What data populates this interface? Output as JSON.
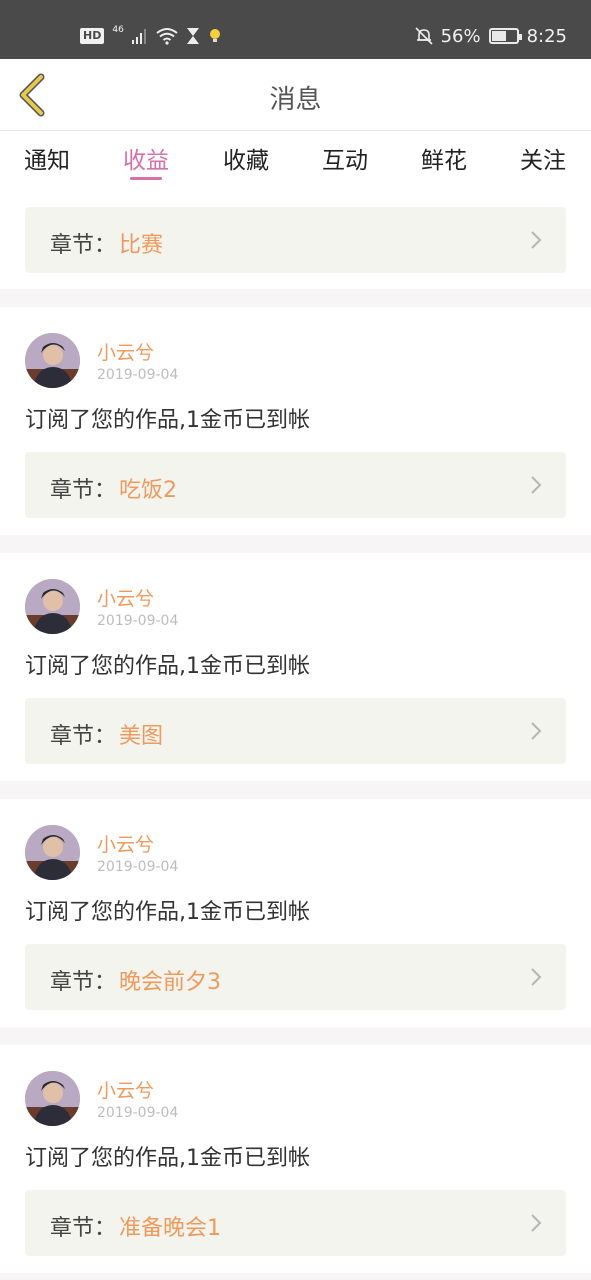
{
  "status_bar": {
    "hd": "HD",
    "network": "46",
    "battery_text": "56%",
    "battery_level": 0.56,
    "time": "8:25"
  },
  "header": {
    "title": "消息"
  },
  "tabs": [
    {
      "label": "通知"
    },
    {
      "label": "收益"
    },
    {
      "label": "收藏"
    },
    {
      "label": "互动"
    },
    {
      "label": "鲜花"
    },
    {
      "label": "关注"
    }
  ],
  "active_tab": "收益",
  "chapter_label": "章节：",
  "first_card": {
    "chapter": "比赛"
  },
  "cards": [
    {
      "user": "小云兮",
      "date": "2019-09-04",
      "message": "订阅了您的作品,1金币已到帐",
      "chapter": "吃饭2"
    },
    {
      "user": "小云兮",
      "date": "2019-09-04",
      "message": "订阅了您的作品,1金币已到帐",
      "chapter": "美图"
    },
    {
      "user": "小云兮",
      "date": "2019-09-04",
      "message": "订阅了您的作品,1金币已到帐",
      "chapter": "晚会前夕3"
    },
    {
      "user": "小云兮",
      "date": "2019-09-04",
      "message": "订阅了您的作品,1金币已到帐",
      "chapter": "准备晚会1"
    }
  ],
  "colors": {
    "accent_pink": "#d870a8",
    "accent_orange": "#ef9a5d",
    "back_arrow": "#e8c84a"
  }
}
